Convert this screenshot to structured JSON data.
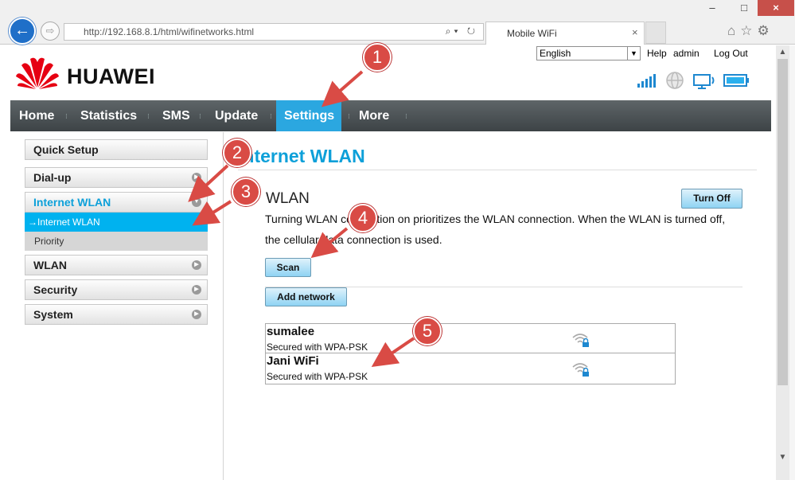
{
  "browser": {
    "url": "http://192.168.8.1/html/wifinetworks.html",
    "tab_title": "Mobile WiFi",
    "tab_close": "×",
    "back_icon": "←",
    "forward_icon": "⇨",
    "addr_icons": "⌕▾ ↻",
    "win_min": "–",
    "win_max": "□",
    "win_close": "×",
    "tool_icons": "⌂☆⚙",
    "scroll_up": "▲",
    "scroll_down": "▼"
  },
  "header": {
    "logo_text": "HUAWEI",
    "brand_color": "#e60012",
    "language": "English",
    "help": "Help",
    "user": "admin",
    "logout": "Log Out"
  },
  "nav": {
    "items": [
      "Home",
      "Statistics",
      "SMS",
      "Update",
      "Settings",
      "More"
    ],
    "active": "Settings",
    "accent": "#2ba7e0"
  },
  "sidebar": {
    "quick_setup": "Quick Setup",
    "dialup": "Dial-up",
    "internet_wlan": "Internet WLAN",
    "sub_internet_wlan": "→Internet WLAN",
    "sub_priority": "Priority",
    "wlan": "WLAN",
    "security": "Security",
    "system": "System"
  },
  "main": {
    "page_title": "Internet WLAN",
    "section_heading": "WLAN",
    "turn_off": "Turn Off",
    "desc_line1": "Turning WLAN connection on prioritizes the WLAN connection. When the WLAN is turned off,",
    "desc_line2": "the cellular data connection is used.",
    "scan": "Scan",
    "add_network": "Add network",
    "networks": [
      {
        "name": "sumalee",
        "security": "Secured with WPA-PSK"
      },
      {
        "name": "Jani WiFi",
        "security": "Secured with WPA-PSK"
      }
    ]
  },
  "callouts": [
    "1",
    "2",
    "3",
    "4",
    "5"
  ]
}
